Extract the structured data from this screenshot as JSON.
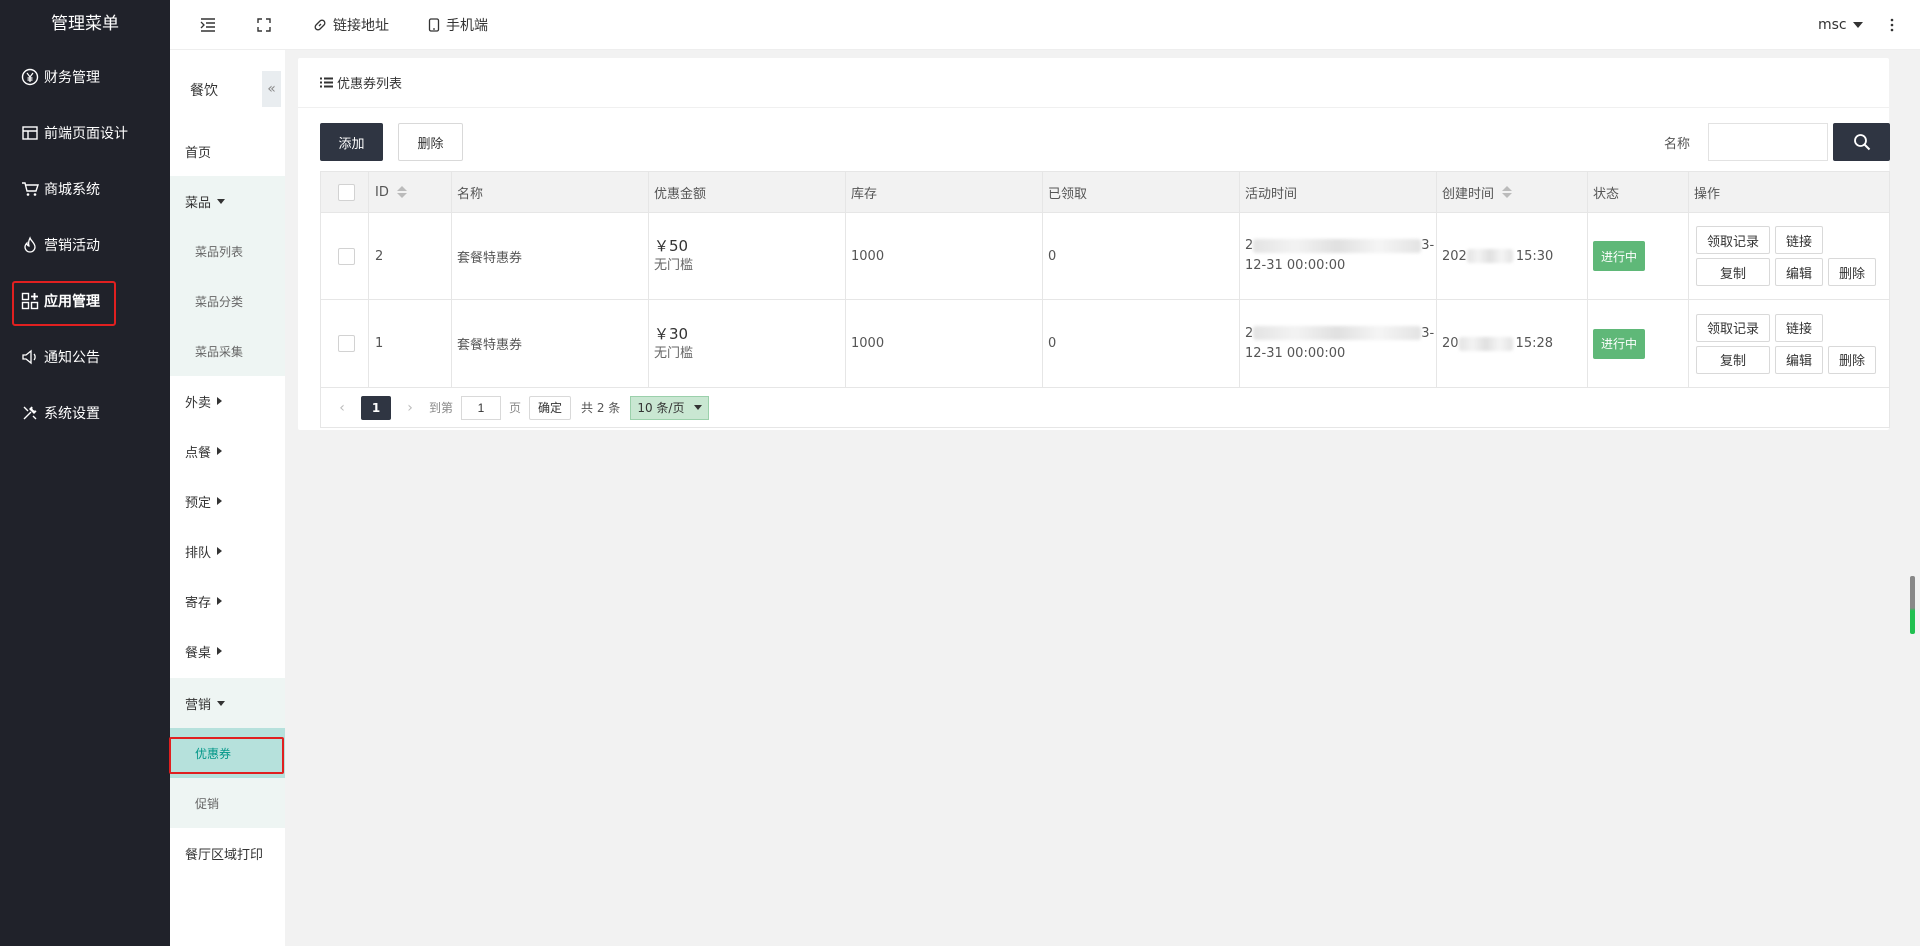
{
  "sidebar": {
    "title": "管理菜单",
    "items": [
      {
        "label": "财务管理",
        "icon": "yen-circle-icon"
      },
      {
        "label": "前端页面设计",
        "icon": "layout-icon"
      },
      {
        "label": "商城系统",
        "icon": "cart-icon"
      },
      {
        "label": "营销活动",
        "icon": "fire-icon"
      },
      {
        "label": "应用管理",
        "icon": "apps-icon"
      },
      {
        "label": "通知公告",
        "icon": "speaker-icon"
      },
      {
        "label": "系统设置",
        "icon": "tools-icon"
      }
    ]
  },
  "topbar": {
    "link_label": "链接地址",
    "mobile_label": "手机端",
    "user": "msc"
  },
  "submenu": {
    "title": "餐饮",
    "collapse": "«",
    "home": "首页",
    "dishes": "菜品",
    "dishes_children": [
      "菜品列表",
      "菜品分类",
      "菜品采集"
    ],
    "groups": [
      "外卖",
      "点餐",
      "预定",
      "排队",
      "寄存",
      "餐桌"
    ],
    "marketing": "营销",
    "marketing_children": [
      "优惠券",
      "促销"
    ],
    "print": "餐厅区域打印"
  },
  "card": {
    "title": "优惠券列表",
    "add_label": "添加",
    "delete_label": "删除",
    "search_label": "名称",
    "search_value": ""
  },
  "table": {
    "headers": [
      "ID",
      "名称",
      "优惠金额",
      "库存",
      "已领取",
      "活动时间",
      "创建时间",
      "状态",
      "操作"
    ],
    "rows": [
      {
        "id": "2",
        "name": "套餐特惠券",
        "amount": "￥50",
        "threshold": "无门槛",
        "stock": "1000",
        "received": "0",
        "time_line1_start": "2",
        "time_line1_end": "3-",
        "time_line2": "12-31 00:00:00",
        "created_start": "202",
        "created_end": "15:30",
        "status": "进行中"
      },
      {
        "id": "1",
        "name": "套餐特惠券",
        "amount": "￥30",
        "threshold": "无门槛",
        "stock": "1000",
        "received": "0",
        "time_line1_start": "2",
        "time_line1_end": "3-",
        "time_line2": "12-31 00:00:00",
        "created_start": "20",
        "created_end": "15:28",
        "status": "进行中"
      }
    ],
    "ops": [
      "领取记录",
      "链接",
      "复制",
      "编辑",
      "删除"
    ]
  },
  "pager": {
    "current": "1",
    "goto_label": "到第",
    "goto_value": "1",
    "page_label": "页",
    "confirm_label": "确定",
    "total_label": "共 2 条",
    "page_size": "10 条/页"
  },
  "colors": {
    "sidebar_bg": "#20222a",
    "dark_button": "#2f3542",
    "status_green": "#5fb878",
    "active_sub": "#b6e1dc",
    "highlight_red": "#e02020"
  }
}
